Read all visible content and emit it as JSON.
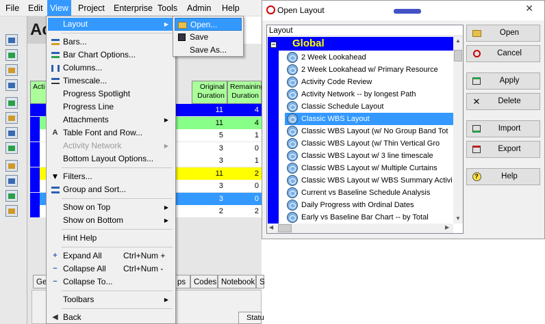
{
  "menubar": {
    "items": [
      "File",
      "Edit",
      "View",
      "Project",
      "Enterprise",
      "Tools",
      "Admin",
      "Help"
    ]
  },
  "app": {
    "title_fragment": "Ac"
  },
  "grid": {
    "headers": {
      "first": "Acti",
      "original": "Original Duration",
      "remaining": "Remaining Duration"
    },
    "rows": [
      {
        "orig": "11",
        "rem": "4",
        "style": "blue"
      },
      {
        "orig": "11",
        "rem": "4",
        "style": "green"
      },
      {
        "orig": "5",
        "rem": "1",
        "style": "white"
      },
      {
        "orig": "3",
        "rem": "0",
        "style": "white"
      },
      {
        "orig": "3",
        "rem": "1",
        "style": "white"
      },
      {
        "orig": "11",
        "rem": "2",
        "style": "yellow"
      },
      {
        "orig": "3",
        "rem": "0",
        "style": "white"
      },
      {
        "orig": "3",
        "rem": "0",
        "style": "selected"
      },
      {
        "orig": "2",
        "rem": "2",
        "style": "white"
      }
    ]
  },
  "bottom_tabs": [
    "Ge",
    "ps",
    "Codes",
    "Notebook",
    "S"
  ],
  "bottom_status": "Statu",
  "view_menu": {
    "items": [
      {
        "label": "Layout",
        "submenu": true,
        "highlighted": true
      },
      {
        "sep": true
      },
      {
        "label": "Bars...",
        "icon": "bars-icon"
      },
      {
        "label": "Bar Chart Options...",
        "icon": "bar-chart-options-icon"
      },
      {
        "label": "Columns...",
        "icon": "columns-icon"
      },
      {
        "label": "Timescale...",
        "icon": "timescale-icon"
      },
      {
        "label": "Progress Spotlight"
      },
      {
        "label": "Progress Line"
      },
      {
        "label": "Attachments",
        "submenu": true
      },
      {
        "label": "Table Font and Row...",
        "icon": "table-font-icon"
      },
      {
        "label": "Activity Network",
        "submenu": true,
        "disabled": true
      },
      {
        "label": "Bottom Layout Options..."
      },
      {
        "sep": true
      },
      {
        "label": "Filters...",
        "icon": "filter-icon"
      },
      {
        "label": "Group and Sort...",
        "icon": "group-sort-icon"
      },
      {
        "sep": true
      },
      {
        "label": "Show on Top",
        "submenu": true
      },
      {
        "label": "Show on Bottom",
        "submenu": true
      },
      {
        "sep": true
      },
      {
        "label": "Hint Help"
      },
      {
        "sep": true
      },
      {
        "label": "Expand All",
        "shortcut": "Ctrl+Num +",
        "icon": "expand-all-icon"
      },
      {
        "label": "Collapse All",
        "shortcut": "Ctrl+Num -",
        "icon": "collapse-all-icon"
      },
      {
        "label": "Collapse To...",
        "icon": "collapse-to-icon"
      },
      {
        "sep": true
      },
      {
        "label": "Toolbars",
        "submenu": true
      },
      {
        "sep": true
      },
      {
        "label": "Back",
        "icon": "back-icon"
      }
    ]
  },
  "layout_submenu": {
    "items": [
      "Open...",
      "Save",
      "Save As..."
    ]
  },
  "dialog": {
    "title": "Open Layout",
    "list_header": "Layout",
    "group": "Global",
    "layouts": [
      "2 Week Lookahead",
      "2 Week Lookahead w/ Primary Resource",
      "Activity Code Review",
      "Activity Network -- by longest Path",
      "Classic Schedule Layout",
      "Classic WBS Layout",
      "Classic WBS Layout (w/ No Group Band Tot",
      "Classic WBS Layout (w/ Thin Vertical Gro",
      "Classic WBS Layout w/ 3 line timescale",
      "Classic WBS Layout w/ Multiple Curtains",
      "Classic WBS Layout w/ WBS Summary Activi",
      "Current vs Baseline Schedule Analysis",
      "Daily Progress with Ordinal Dates",
      "Early vs Baseline Bar Chart -- by Total"
    ],
    "selected_index": 5,
    "buttons": [
      "Open",
      "Cancel",
      "Apply",
      "Delete",
      "Import",
      "Export",
      "Help"
    ]
  },
  "colors": {
    "menu_highlight": "#3399ff",
    "grid_blue": "#0000ff",
    "grid_green": "#88ff88",
    "grid_yellow": "#ffff00",
    "group_text": "#ffff00"
  }
}
